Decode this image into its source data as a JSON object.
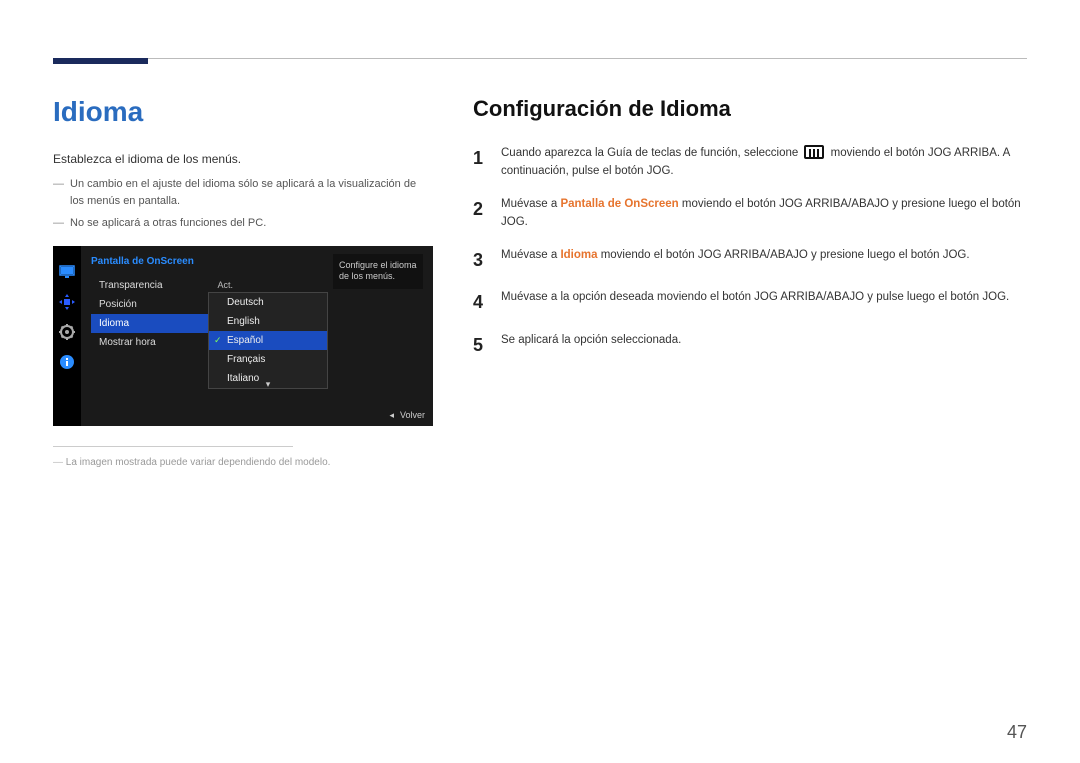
{
  "left": {
    "title": "Idioma",
    "intro": "Establezca el idioma de los menús.",
    "notes": [
      "Un cambio en el ajuste del idioma sólo se aplicará a la visualización de los menús en pantalla.",
      "No se aplicará a otras funciones del PC."
    ],
    "footnote": "La imagen mostrada puede variar dependiendo del modelo."
  },
  "osd": {
    "header": "Pantalla de OnScreen",
    "tooltip": "Configure el idioma de los menús.",
    "footer": "Volver",
    "menu": [
      {
        "label": "Transparencia",
        "value": "Act."
      },
      {
        "label": "Posición",
        "value": ""
      },
      {
        "label": "Idioma",
        "value": "",
        "selected": true
      },
      {
        "label": "Mostrar hora",
        "value": ""
      }
    ],
    "dropdown": [
      {
        "label": "Deutsch"
      },
      {
        "label": "English"
      },
      {
        "label": "Español",
        "selected": true
      },
      {
        "label": "Français"
      },
      {
        "label": "Italiano"
      }
    ],
    "icons": [
      "monitor-icon",
      "move-icon",
      "gear-icon",
      "info-icon"
    ]
  },
  "right": {
    "title": "Configuración de Idioma",
    "steps": [
      {
        "num": "1",
        "pre": "Cuando aparezca la Guía de teclas de función, seleccione ",
        "icon": true,
        "post": " moviendo el botón JOG ARRIBA. A continuación, pulse el botón JOG."
      },
      {
        "num": "2",
        "pre": "Muévase a ",
        "hl": "Pantalla de OnScreen",
        "post": " moviendo el botón JOG ARRIBA/ABAJO y presione luego el botón JOG."
      },
      {
        "num": "3",
        "pre": "Muévase a ",
        "hl": "Idioma",
        "post": " moviendo el botón JOG ARRIBA/ABAJO y presione luego el botón JOG."
      },
      {
        "num": "4",
        "pre": "Muévase a la opción deseada moviendo el botón JOG ARRIBA/ABAJO y pulse luego el botón JOG."
      },
      {
        "num": "5",
        "pre": "Se aplicará la opción seleccionada."
      }
    ]
  },
  "pagenum": "47"
}
